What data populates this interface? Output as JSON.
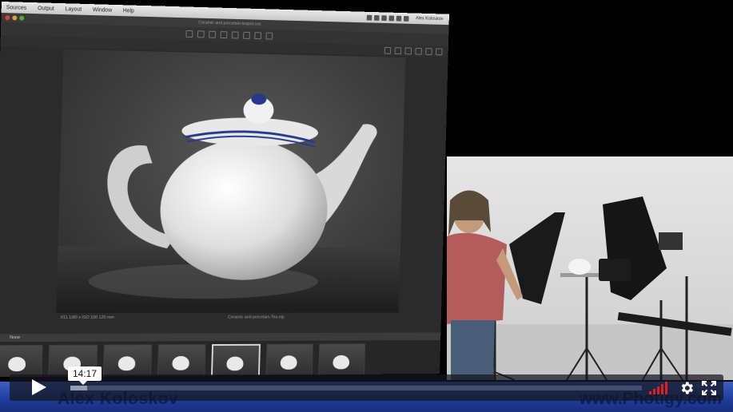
{
  "app": {
    "menu": [
      "Sources",
      "Output",
      "Layout",
      "Window",
      "Help"
    ],
    "user_name": "Alex Koloskov",
    "window_title": "Ceramic and porcelain-teapot.cos",
    "viewer_caption": "Ceramic and porcelain-Tea.eip",
    "viewer_info_left": "f/11   1/80 s   ISO 100   120 mm",
    "filmstrip_label": "None",
    "filmstrip_thumbnails": 7,
    "selected_thumbnail": 5
  },
  "overlay": {
    "presenter_name": "Alex Koloskov",
    "website": "www.Photigy.com"
  },
  "player": {
    "time_tooltip": "14:17",
    "progress": 0.03,
    "volume_level": 5,
    "colors": {
      "volume": "#e02020",
      "controls_bg": "#14161e",
      "title_bar": "#1f3c9a"
    }
  },
  "icons": [
    "play-icon",
    "volume-icon",
    "settings-gear-icon",
    "fullscreen-icon"
  ]
}
